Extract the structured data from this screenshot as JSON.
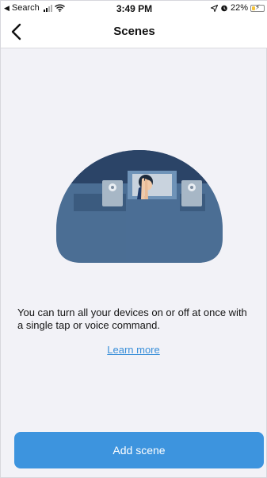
{
  "status_bar": {
    "back_app": "Search",
    "time": "3:49 PM",
    "battery": "22%",
    "battery_level": 0.22
  },
  "nav": {
    "title": "Scenes",
    "back_icon": "chevron-left-icon"
  },
  "content": {
    "illustration_icon": "bedroom-scene-illustration",
    "description": "You can turn all your devices on or off at once with a single tap or voice command.",
    "learn_more": "Learn more"
  },
  "actions": {
    "add_scene": "Add scene"
  },
  "colors": {
    "accent": "#3d94de",
    "link": "#3a8fd9",
    "background": "#f2f2f7",
    "illustration_dark": "#2f4a6e",
    "illustration_mid": "#4a6a8e"
  }
}
